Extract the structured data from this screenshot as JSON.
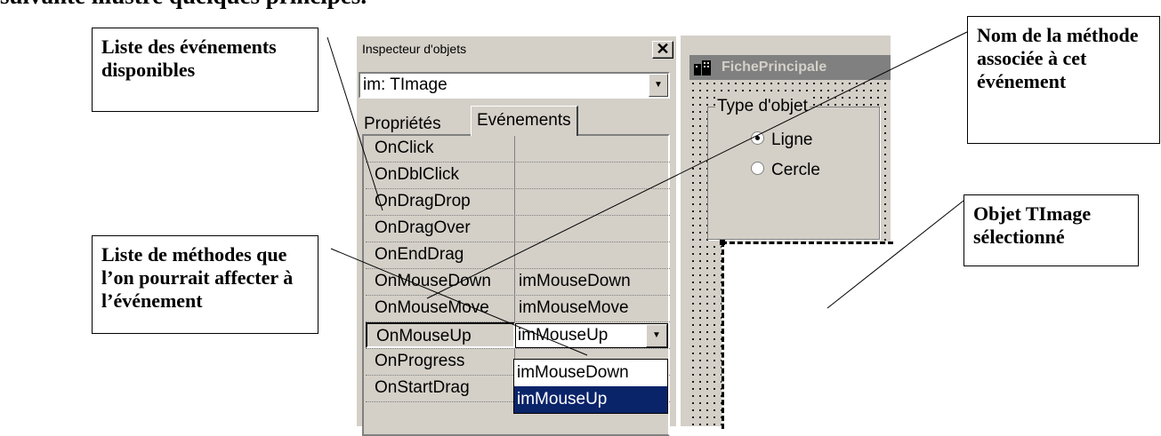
{
  "intro_text": "suivante illustre quelques principes.",
  "callouts": {
    "events_list": "Liste des événements disponibles",
    "method_name": "Nom de la méthode associée à cet événement",
    "methods_list": "Liste de méthodes que l’on pourrait affecter à l’événement",
    "timage_selected": "Objet TImage sélectionné"
  },
  "inspector": {
    "title": "Inspecteur d'objets",
    "close_glyph": "✕",
    "object_selector": "im: TImage",
    "tabs": [
      {
        "label": "Propriétés"
      },
      {
        "label": "Evénements"
      }
    ],
    "events": [
      {
        "name": "OnClick",
        "value": ""
      },
      {
        "name": "OnDblClick",
        "value": ""
      },
      {
        "name": "OnDragDrop",
        "value": ""
      },
      {
        "name": "OnDragOver",
        "value": ""
      },
      {
        "name": "OnEndDrag",
        "value": ""
      },
      {
        "name": "OnMouseDown",
        "value": "imMouseDown"
      },
      {
        "name": "OnMouseMove",
        "value": "imMouseMove"
      },
      {
        "name": "OnMouseUp",
        "value": "imMouseUp"
      },
      {
        "name": "OnProgress",
        "value": ""
      },
      {
        "name": "OnStartDrag",
        "value": ""
      }
    ],
    "dropdown_options": [
      "imMouseDown",
      "imMouseUp"
    ]
  },
  "form": {
    "title": "FichePrincipale",
    "group_title": "Type d'objet",
    "radios": [
      {
        "label": "Ligne",
        "checked": true
      },
      {
        "label": "Cercle",
        "checked": false
      }
    ]
  }
}
